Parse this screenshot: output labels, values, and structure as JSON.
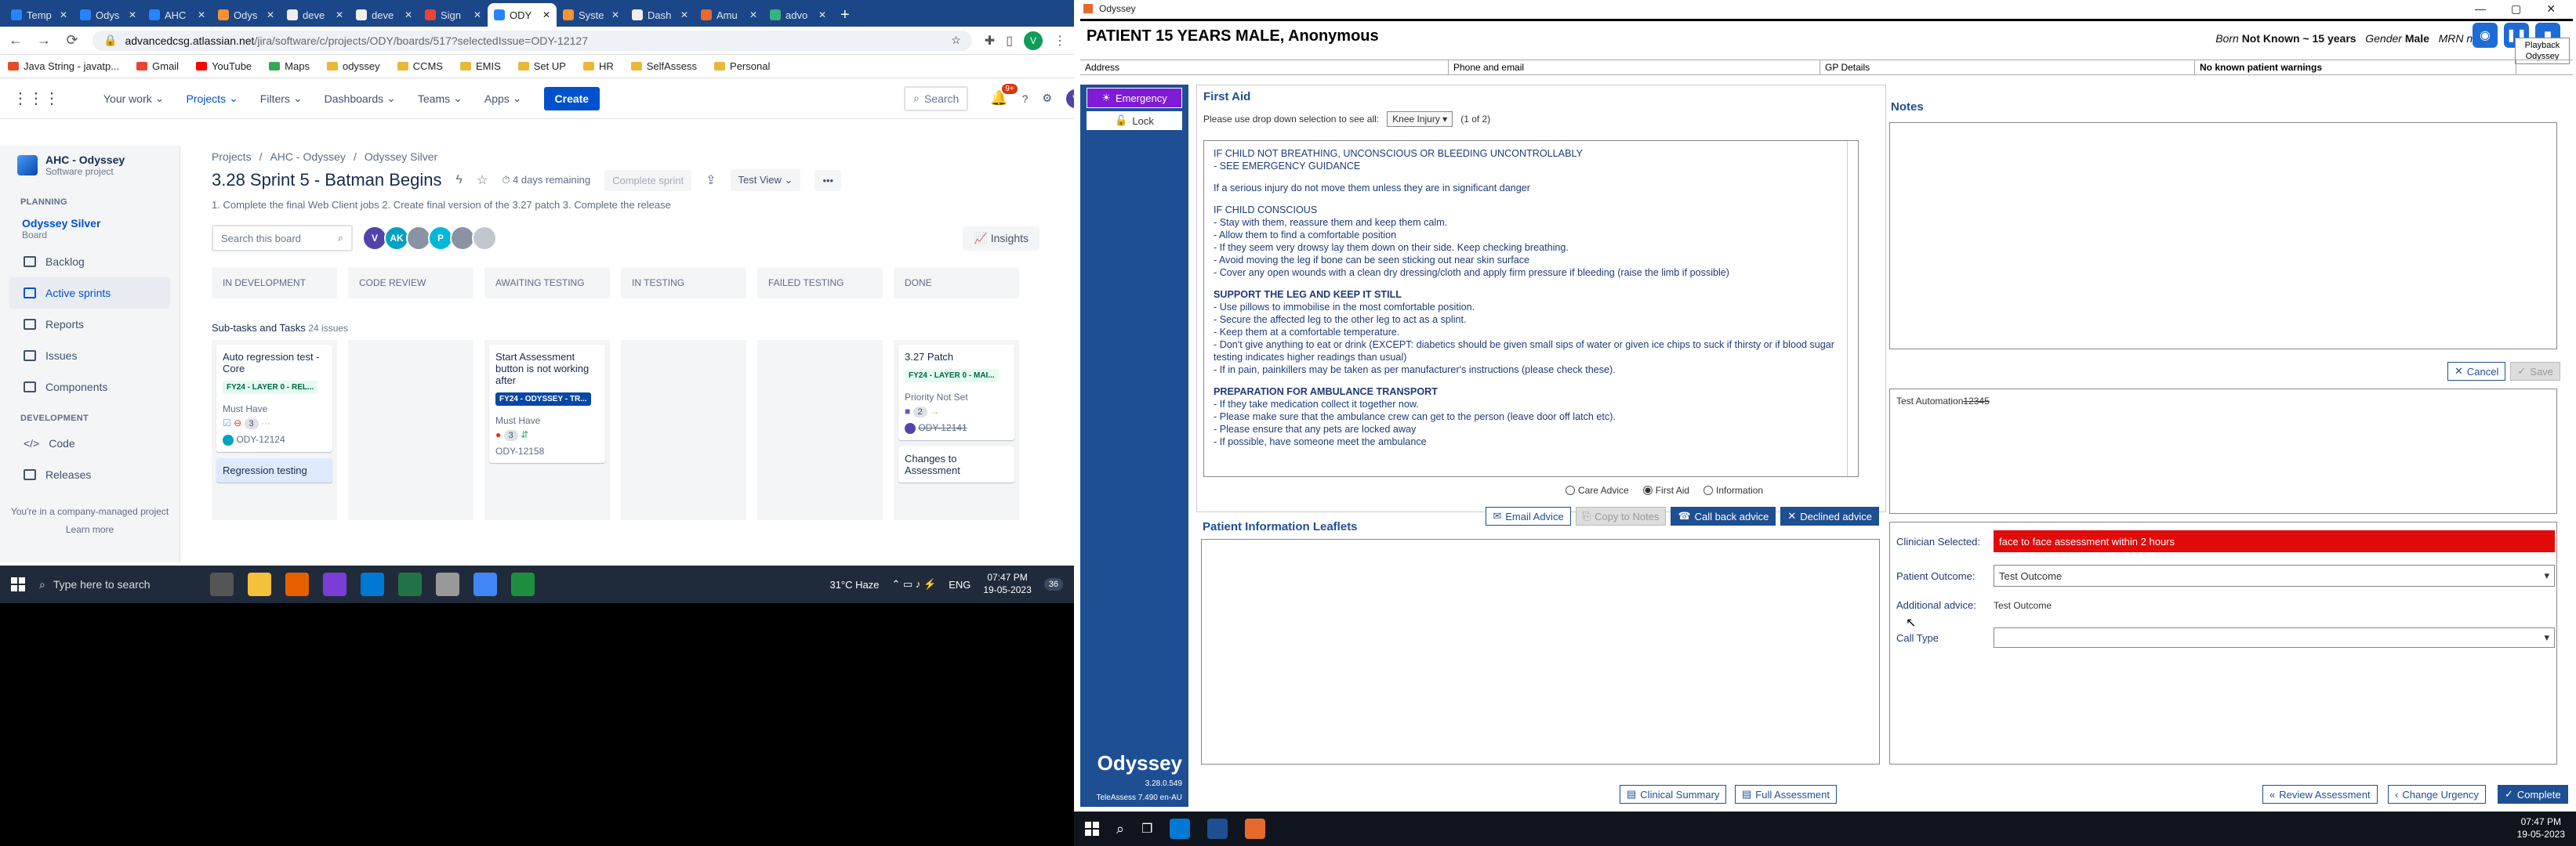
{
  "browser": {
    "tabs": [
      {
        "title": "Temp",
        "color": "#2684ff"
      },
      {
        "title": "Odys",
        "color": "#2684ff"
      },
      {
        "title": "AHC",
        "color": "#2684ff"
      },
      {
        "title": "Odys",
        "color": "#f79232"
      },
      {
        "title": "deve",
        "color": "#eeeeee"
      },
      {
        "title": "deve",
        "color": "#eeeeee"
      },
      {
        "title": "Sign",
        "color": "#ea4335"
      },
      {
        "title": "ODY",
        "color": "#2684ff"
      },
      {
        "title": "Syste",
        "color": "#f79232"
      },
      {
        "title": "Dash",
        "color": "#eeeeee"
      },
      {
        "title": "Amu",
        "color": "#e66a2c"
      },
      {
        "title": "advo",
        "color": "#36b37e"
      }
    ],
    "active_tab_index": 7,
    "url_host": "advancedcsg.atlassian.net",
    "url_path": "/jira/software/c/projects/ODY/boards/517?selectedIssue=ODY-12127",
    "profile_initial": "V",
    "bookmarks": [
      {
        "label": "Java String - javatp...",
        "color": "#e34c26"
      },
      {
        "label": "Gmail",
        "color": "#ea4335"
      },
      {
        "label": "YouTube",
        "color": "#ff0000"
      },
      {
        "label": "Maps",
        "color": "#34a853"
      },
      {
        "label": "odyssey",
        "color": "#e9b838"
      },
      {
        "label": "CCMS",
        "color": "#e9b838"
      },
      {
        "label": "EMIS",
        "color": "#e9b838"
      },
      {
        "label": "Set UP",
        "color": "#e9b838"
      },
      {
        "label": "HR",
        "color": "#e9b838"
      },
      {
        "label": "SelfAssess",
        "color": "#e9b838"
      },
      {
        "label": "Personal",
        "color": "#e9b838"
      }
    ]
  },
  "jira": {
    "nav": [
      "Your work",
      "Projects",
      "Filters",
      "Dashboards",
      "Teams",
      "Apps"
    ],
    "create": "Create",
    "search_placeholder": "Search",
    "notif_badge": "9+",
    "user_initial": "V",
    "project": {
      "name": "AHC - Odyssey",
      "type": "Software project"
    },
    "planning_label": "PLANNING",
    "board": {
      "name": "Odyssey Silver",
      "sub": "Board"
    },
    "side_items": [
      "Backlog",
      "Active sprints",
      "Reports",
      "Issues",
      "Components"
    ],
    "development_label": "DEVELOPMENT",
    "dev_items": [
      "Code",
      "Releases"
    ],
    "managed": "You're in a company-managed project",
    "learn_more": "Learn more",
    "breadcrumb": [
      "Projects",
      "/",
      "AHC - Odyssey",
      "/",
      "Odyssey Silver"
    ],
    "sprint_title": "3.28 Sprint 5 - Batman Begins",
    "days_remaining": "4 days remaining",
    "complete_sprint": "Complete sprint",
    "view": "Test View",
    "goal": "1. Complete the final Web Client jobs 2. Create final version of the 3.27 patch 3. Complete the release",
    "board_search": "Search this board",
    "assignees": [
      {
        "initial": "V",
        "color": "#5243aa"
      },
      {
        "initial": "AK",
        "color": "#00a3bf"
      },
      {
        "initial": "",
        "color": "#8993a4"
      },
      {
        "initial": "P",
        "color": "#00b8d9"
      },
      {
        "initial": "",
        "color": "#8993a4"
      },
      {
        "initial": "",
        "color": "#c1c7d0"
      }
    ],
    "insights": "Insights",
    "columns": [
      "IN DEVELOPMENT",
      "CODE REVIEW",
      "AWAITING TESTING",
      "IN TESTING",
      "FAILED TESTING",
      "DONE"
    ],
    "swimlane": "Sub-tasks and Tasks",
    "swimlane_count": "24 issues",
    "cards": {
      "c1_title": "Auto regression test - Core",
      "c1_epic": "FY24 - LAYER 0 - REL...",
      "c1_priority": "Must Have",
      "c1_points": "3",
      "c1_key": "ODY-12124",
      "c1b_title": "Regression testing",
      "c3_title": "Start Assessment button is not working after",
      "c3_epic": "FY24 - ODYSSEY - TR...",
      "c3_priority": "Must Have",
      "c3_points": "3",
      "c3_key": "ODY-12158",
      "c6_title": "3.27 Patch",
      "c6_epic": "FY24 - LAYER 0 - MAI...",
      "c6_priority": "Priority Not Set",
      "c6_points": "2",
      "c6_key": "ODY-12141",
      "c6b_title": "Changes to Assessment"
    },
    "partial_left": "or"
  },
  "taskbar_left": {
    "search": "Type here to search",
    "weather": "31°C  Haze",
    "lang": "ENG",
    "time": "07:47 PM",
    "date": "19-05-2023",
    "notif": "36"
  },
  "odyssey": {
    "window_title": "Odyssey",
    "patient_header": "PATIENT 15 YEARS MALE, Anonymous",
    "born_label": "Born",
    "born_value": "Not Known ~ 15 years",
    "gender_label": "Gender",
    "gender_value": "Male",
    "mrn_label": "MRN no",
    "playback": "Playback Odyssey",
    "info_address": "Address",
    "info_phone": "Phone and email",
    "info_gp": "GP Details",
    "info_warnings": "No known patient warnings",
    "emergency": "Emergency",
    "lock": "Lock",
    "brand": "Odyssey",
    "version": "3.28.0.549",
    "teleassess": "TeleAssess 7.490 en-AU",
    "first_aid_title": "First Aid",
    "dropdown_prompt": "Please use drop down selection to see all:",
    "dropdown_value": "Knee Injury",
    "dropdown_count": "(1 of 2)",
    "fa_lines": [
      {
        "t": "IF CHILD NOT BREATHING, UNCONSCIOUS OR BLEEDING UNCONTROLLABLY",
        "h": false
      },
      {
        "t": "- SEE EMERGENCY GUIDANCE",
        "h": false
      },
      {
        "t": "",
        "h": false
      },
      {
        "t": "If a serious injury do not move them unless they are in significant danger",
        "h": false
      },
      {
        "t": "",
        "h": false
      },
      {
        "t": "IF CHILD CONSCIOUS",
        "h": false
      },
      {
        "t": "- Stay with them, reassure them and keep them calm.",
        "h": false
      },
      {
        "t": "- Allow them to find a comfortable position",
        "h": false
      },
      {
        "t": "- If they seem very drowsy lay them down on their side. Keep checking breathing.",
        "h": false
      },
      {
        "t": "- Avoid moving the leg if bone can be seen sticking out near skin surface",
        "h": false
      },
      {
        "t": "- Cover any open wounds with a clean dry dressing/cloth and apply firm pressure if bleeding (raise the limb if possible)",
        "h": false
      },
      {
        "t": "",
        "h": false
      },
      {
        "t": "SUPPORT THE LEG AND KEEP IT STILL",
        "h": true
      },
      {
        "t": "- Use pillows to immobilise in the most comfortable position.",
        "h": false
      },
      {
        "t": "- Secure the affected leg to the other leg to act as a splint.",
        "h": false
      },
      {
        "t": "- Keep them at a comfortable temperature.",
        "h": false
      },
      {
        "t": "- Don't give anything to eat or drink (EXCEPT: diabetics should be given small sips of water or given ice chips to suck if thirsty or if blood sugar testing indicates higher readings than usual)",
        "h": false
      },
      {
        "t": "- If in pain, painkillers may be taken as per manufacturer's instructions (please check these).",
        "h": false
      },
      {
        "t": "",
        "h": false
      },
      {
        "t": "PREPARATION FOR AMBULANCE TRANSPORT",
        "h": true
      },
      {
        "t": "- If they take medication collect it together now.",
        "h": false
      },
      {
        "t": "- Please make sure that the ambulance crew can get to the person (leave door off latch etc).",
        "h": false
      },
      {
        "t": "- Please ensure that any pets are locked away",
        "h": false
      },
      {
        "t": "- If possible, have someone meet the ambulance",
        "h": false
      }
    ],
    "radio_care": "Care Advice",
    "radio_first": "First Aid",
    "radio_info": "Information",
    "btn_email": "Email Advice",
    "btn_copy": "Copy to Notes",
    "btn_callback": "Call back advice",
    "btn_declined": "Declined advice",
    "notes_title": "Notes",
    "btn_cancel": "Cancel",
    "btn_save": "Save",
    "ta_text_a": "Test Automation",
    "ta_text_b": "12345",
    "pil_title": "Patient Information Leaflets",
    "clinician_label": "Clinician Selected:",
    "clinician_value": "face to face assessment within 2 hours",
    "outcome_label": "Patient Outcome:",
    "outcome_value": "Test Outcome",
    "additional_label": "Additional advice:",
    "additional_value": "Test Outcome",
    "calltype_label": "Call Type",
    "btn_clinical": "Clinical Summary",
    "btn_full": "Full Assessment",
    "btn_review": "Review Assessment",
    "btn_urgency": "Change Urgency",
    "btn_complete": "Complete"
  },
  "taskbar_right": {
    "time": "07:47 PM",
    "date": "19-05-2023"
  }
}
